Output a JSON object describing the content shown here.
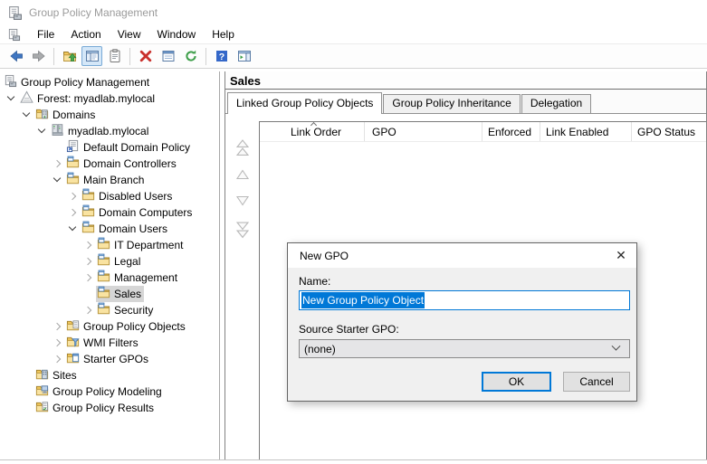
{
  "window": {
    "title": "Group Policy Management"
  },
  "menu": {
    "items": [
      "File",
      "Action",
      "View",
      "Window",
      "Help"
    ]
  },
  "toolbar": {
    "buttons": [
      {
        "name": "back",
        "icon": "arrow-left"
      },
      {
        "name": "forward",
        "icon": "arrow-right"
      },
      {
        "divider": true
      },
      {
        "name": "up-one-level",
        "icon": "folder-up"
      },
      {
        "name": "show-console-tree",
        "icon": "console-tree",
        "active": true
      },
      {
        "name": "export-list",
        "icon": "clipboard"
      },
      {
        "divider": true
      },
      {
        "name": "delete",
        "icon": "delete-x"
      },
      {
        "name": "properties",
        "icon": "properties"
      },
      {
        "name": "refresh",
        "icon": "refresh"
      },
      {
        "divider": true
      },
      {
        "name": "help",
        "icon": "help"
      },
      {
        "name": "show-action-pane",
        "icon": "action-pane"
      }
    ]
  },
  "tree": {
    "items": [
      {
        "level": 0,
        "expand": "none",
        "icon": "gpmc",
        "label": "Group Policy Management",
        "selected": false
      },
      {
        "level": 1,
        "expand": "expanded",
        "icon": "forest",
        "label": "Forest: myadlab.mylocal",
        "selected": false
      },
      {
        "level": 2,
        "expand": "expanded",
        "icon": "domains",
        "label": "Domains",
        "selected": false
      },
      {
        "level": 3,
        "expand": "expanded",
        "icon": "domain",
        "label": "myadlab.mylocal",
        "selected": false
      },
      {
        "level": 4,
        "expand": "none",
        "icon": "gpo-link",
        "label": "Default Domain Policy",
        "selected": false
      },
      {
        "level": 4,
        "expand": "collapsed",
        "icon": "ou",
        "label": "Domain Controllers",
        "selected": false
      },
      {
        "level": 4,
        "expand": "expanded",
        "icon": "ou",
        "label": "Main Branch",
        "selected": false
      },
      {
        "level": 5,
        "expand": "collapsed",
        "icon": "ou",
        "label": "Disabled Users",
        "selected": false
      },
      {
        "level": 5,
        "expand": "collapsed",
        "icon": "ou",
        "label": "Domain Computers",
        "selected": false
      },
      {
        "level": 5,
        "expand": "expanded",
        "icon": "ou",
        "label": "Domain Users",
        "selected": false
      },
      {
        "level": 6,
        "expand": "collapsed",
        "icon": "ou",
        "label": "IT Department",
        "selected": false
      },
      {
        "level": 6,
        "expand": "collapsed",
        "icon": "ou",
        "label": "Legal",
        "selected": false
      },
      {
        "level": 6,
        "expand": "collapsed",
        "icon": "ou",
        "label": "Management",
        "selected": false
      },
      {
        "level": 6,
        "expand": "none",
        "icon": "ou",
        "label": "Sales",
        "selected": true
      },
      {
        "level": 6,
        "expand": "collapsed",
        "icon": "ou",
        "label": "Security",
        "selected": false
      },
      {
        "level": 4,
        "expand": "collapsed",
        "icon": "gpo-folder",
        "label": "Group Policy Objects",
        "selected": false
      },
      {
        "level": 4,
        "expand": "collapsed",
        "icon": "wmi",
        "label": "WMI Filters",
        "selected": false
      },
      {
        "level": 4,
        "expand": "collapsed",
        "icon": "starter",
        "label": "Starter GPOs",
        "selected": false
      },
      {
        "level": 2,
        "expand": "none",
        "icon": "sites",
        "label": "Sites",
        "selected": false
      },
      {
        "level": 2,
        "expand": "none",
        "icon": "modeling",
        "label": "Group Policy Modeling",
        "selected": false
      },
      {
        "level": 2,
        "expand": "none",
        "icon": "results",
        "label": "Group Policy Results",
        "selected": false
      }
    ]
  },
  "main": {
    "title": "Sales",
    "tabs": [
      {
        "label": "Linked Group Policy Objects",
        "active": true
      },
      {
        "label": "Group Policy Inheritance",
        "active": false
      },
      {
        "label": "Delegation",
        "active": false
      }
    ],
    "table": {
      "columns": [
        {
          "label": "Link Order",
          "sorted": "asc"
        },
        {
          "label": "GPO"
        },
        {
          "label": "Enforced"
        },
        {
          "label": "Link Enabled"
        },
        {
          "label": "GPO Status"
        }
      ],
      "rows": []
    },
    "move_buttons": [
      {
        "name": "move-to-top",
        "icon": "dtri-up"
      },
      {
        "name": "move-up",
        "icon": "tri-up"
      },
      {
        "name": "move-down",
        "icon": "tri-down"
      },
      {
        "name": "move-to-bottom",
        "icon": "dtri-down"
      }
    ]
  },
  "dialog": {
    "title": "New GPO",
    "close_icon": "✕",
    "name_label": "Name:",
    "name_value": "New Group Policy Object",
    "source_label": "Source Starter GPO:",
    "source_value": "(none)",
    "ok_label": "OK",
    "cancel_label": "Cancel"
  },
  "colors": {
    "accent": "#0078d7",
    "selection": "#0078d7",
    "tree_selection_bg": "#d6d6d6",
    "inactive_title": "#9b9b9b"
  }
}
